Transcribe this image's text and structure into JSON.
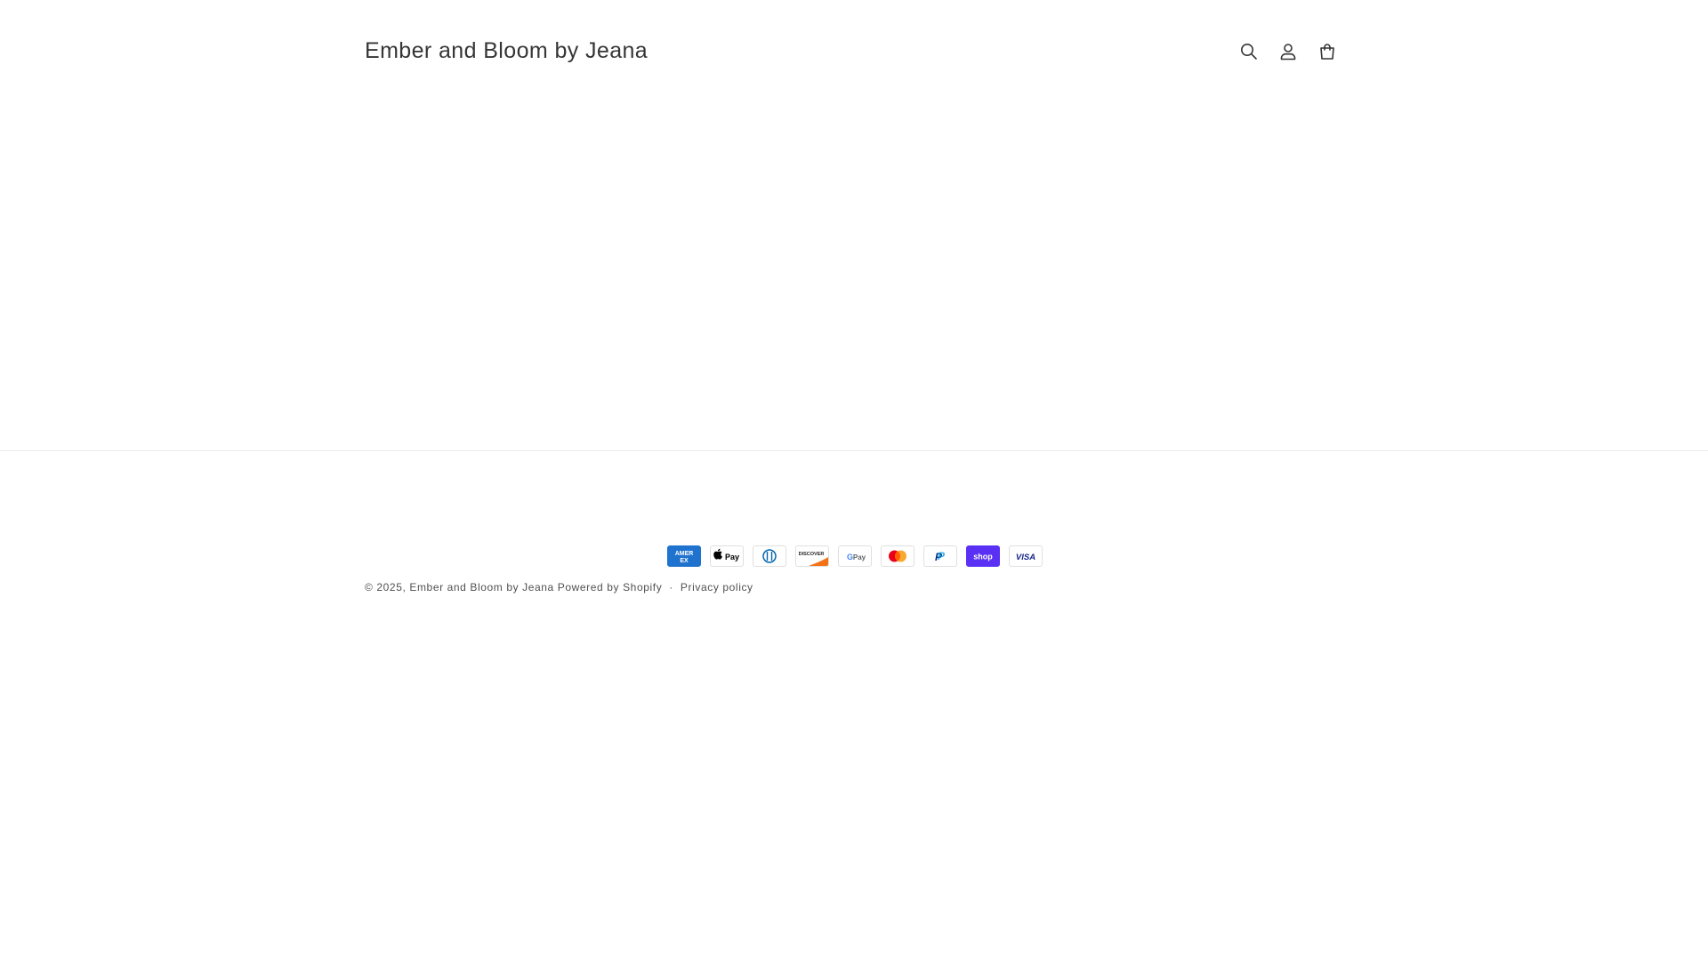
{
  "header": {
    "brand": "Ember and Bloom by Jeana",
    "icons": [
      "search-icon",
      "account-icon",
      "cart-icon"
    ]
  },
  "footer": {
    "payment_methods": [
      {
        "name": "American Express",
        "label": "AMERICAN EXPRESS",
        "color": "#1F72CD"
      },
      {
        "name": "Apple Pay",
        "label": "Pay",
        "color": "#000000"
      },
      {
        "name": "Diners Club",
        "label": "D",
        "color": "#0165AC"
      },
      {
        "name": "Discover",
        "label": "DISCOVER",
        "color": "#F47216"
      },
      {
        "name": "Google Pay",
        "label": "G Pay",
        "color": "#5F6368"
      },
      {
        "name": "Mastercard",
        "label": "",
        "color": "#EB001B"
      },
      {
        "name": "PayPal",
        "label": "P",
        "color": "#003087"
      },
      {
        "name": "Shop Pay",
        "label": "shop",
        "color": "#5A31F4"
      },
      {
        "name": "Visa",
        "label": "VISA",
        "color": "#142688"
      }
    ],
    "copyright_prefix": "© 2025,",
    "store_link": "Ember and Bloom by Jeana",
    "powered_by": "Powered by Shopify",
    "separator": "·",
    "privacy_policy": "Privacy policy"
  }
}
